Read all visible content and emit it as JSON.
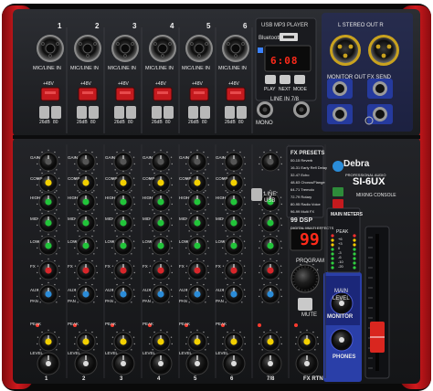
{
  "brand": {
    "name": "Debra",
    "tagline": "PROFESSIONAL AUDIO",
    "model": "SI-6UX",
    "model_subtitle": "MIXING CONSOLE"
  },
  "colors": {
    "body": "#1c1d20",
    "red_side": "#c8181c",
    "knob_yellow": "#f2d000",
    "knob_red": "#d8262a",
    "knob_green": "#22c43a",
    "knob_blue": "#2b8cd8",
    "panel_blue": "#2a3fa8",
    "display": "#ff2a1a"
  },
  "channels": {
    "numbers": [
      "1",
      "2",
      "3",
      "4",
      "5",
      "6"
    ],
    "input_label": "MIC/LINE IN",
    "phantom_label": "+48V",
    "pad_label": "26dB",
    "hpf_label": "80",
    "strip_labels": [
      "GAIN",
      "COMP",
      "HIGH",
      "MID",
      "LOW",
      "FX",
      "AUX",
      "PAN",
      "PEAK",
      "LEVEL"
    ],
    "strip_numbers": [
      "1",
      "2",
      "3",
      "4",
      "5",
      "6",
      "7/8",
      "FX RTN"
    ]
  },
  "top_section": {
    "usb_player_title": "USB MP3 PLAYER",
    "bluetooth_label": "Bluetooth",
    "usb_display": "6:08",
    "transport_labels": [
      "PLAY",
      "NEXT",
      "MODE"
    ],
    "line_in_label": "LINE IN 7/8",
    "mono_label": "MONO",
    "stereo_out_label": "L  STEREO OUT  R",
    "monitor_out_label": "MONITOR OUT",
    "fx_send_label": "FX SEND",
    "line_label": "LINE",
    "usb_label": "USB"
  },
  "fx": {
    "presets_title": "FX PRESETS",
    "presets": [
      "00-15 Reverb",
      "16-31 Early Refl Delay",
      "32-47 Echo",
      "48-63 Chorus/Flange",
      "64-71 Tremolo",
      "72-79 Rotary",
      "80-95 Radio Voice",
      "96-99 Multi FX"
    ],
    "dsp_label": "99 DSP",
    "dsp_subtitle": "DIGITAL MULTI EFFECTS",
    "display_value": "99",
    "program_label": "PROGRAM",
    "mute_label": "MUTE"
  },
  "master": {
    "meter_title": "MAIN METERS",
    "peak_label": "PEAK",
    "meter_scale": [
      "+6",
      "+3",
      "0",
      "-3",
      "-6",
      "-10",
      "-20"
    ],
    "main_label": "MAIN",
    "level_label": "LEVEL",
    "monitor_label": "MONITOR",
    "phones_label": "PHONES"
  }
}
